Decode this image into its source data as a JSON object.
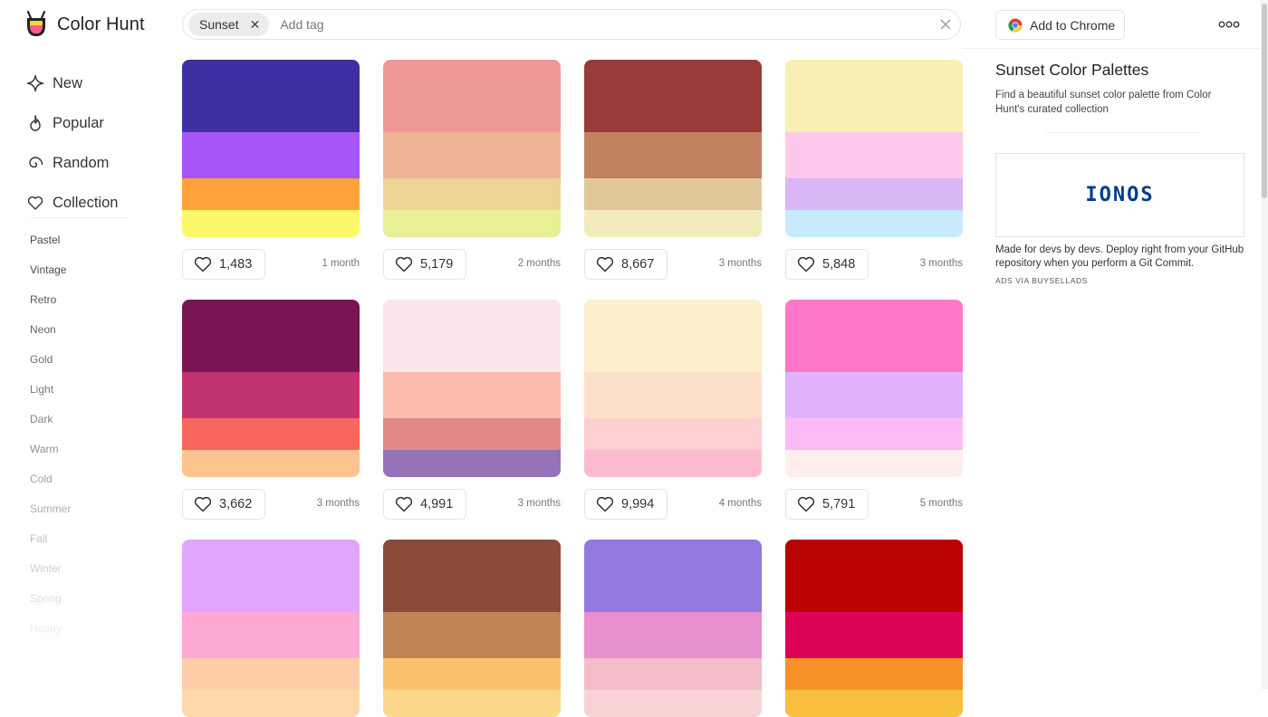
{
  "app": {
    "name": "Color Hunt"
  },
  "search": {
    "tag": "Sunset",
    "placeholder": "Add tag"
  },
  "header": {
    "chrome_label": "Add to Chrome"
  },
  "nav": [
    {
      "label": "New",
      "icon": "sparkle-icon"
    },
    {
      "label": "Popular",
      "icon": "flame-icon"
    },
    {
      "label": "Random",
      "icon": "spiral-icon"
    },
    {
      "label": "Collection",
      "icon": "heart-icon"
    }
  ],
  "tags": [
    {
      "label": "Pastel",
      "color": "#4a4a4a"
    },
    {
      "label": "Vintage",
      "color": "#505050"
    },
    {
      "label": "Retro",
      "color": "#5a5a5a"
    },
    {
      "label": "Neon",
      "color": "#646464"
    },
    {
      "label": "Gold",
      "color": "#6e6e6e"
    },
    {
      "label": "Light",
      "color": "#7a7a7a"
    },
    {
      "label": "Dark",
      "color": "#858585"
    },
    {
      "label": "Warm",
      "color": "#929292"
    },
    {
      "label": "Cold",
      "color": "#a0a0a0"
    },
    {
      "label": "Summer",
      "color": "#b0b0b0"
    },
    {
      "label": "Fall",
      "color": "#c0c0c0"
    },
    {
      "label": "Winter",
      "color": "#cfcfcf"
    },
    {
      "label": "Spring",
      "color": "#dedede"
    },
    {
      "label": "Happy",
      "color": "#ececec"
    }
  ],
  "palettes": [
    {
      "colors": [
        "#3f2fa4",
        "#a855f7",
        "#ffa23c",
        "#fdf86a"
      ],
      "likes": "1,483",
      "date": "1 month"
    },
    {
      "colors": [
        "#ee9896",
        "#efb497",
        "#ecd594",
        "#e9ef94"
      ],
      "likes": "5,179",
      "date": "2 months"
    },
    {
      "colors": [
        "#9a3a3a",
        "#c18262",
        "#e1c89c",
        "#f2ebbd"
      ],
      "likes": "8,667",
      "date": "3 months"
    },
    {
      "colors": [
        "#f9efb2",
        "#fec8ea",
        "#dab7f5",
        "#c8eafd"
      ],
      "likes": "5,848",
      "date": "3 months"
    },
    {
      "colors": [
        "#7b1453",
        "#c2346f",
        "#f6665c",
        "#fec490"
      ],
      "likes": "3,662",
      "date": "3 months"
    },
    {
      "colors": [
        "#fce5eb",
        "#fbbaae",
        "#e38787",
        "#9673b8"
      ],
      "likes": "4,991",
      "date": "3 months"
    },
    {
      "colors": [
        "#fdefcc",
        "#fde0cc",
        "#fdcfd0",
        "#fdbbcf"
      ],
      "likes": "9,994",
      "date": "4 months"
    },
    {
      "colors": [
        "#ff78c8",
        "#e1b2fd",
        "#fdbbf5",
        "#fdeeeb"
      ],
      "likes": "5,791",
      "date": "5 months"
    },
    {
      "colors": [
        "#e2a5fd",
        "#fda9d3",
        "#fdcea9",
        "#fdd9aa"
      ],
      "likes": "",
      "date": ""
    },
    {
      "colors": [
        "#8a4b39",
        "#c08556",
        "#fcc16e",
        "#fcd88c"
      ],
      "likes": "",
      "date": ""
    },
    {
      "colors": [
        "#9378df",
        "#e88fce",
        "#f2bdc8",
        "#f7d3d3"
      ],
      "likes": "",
      "date": ""
    },
    {
      "colors": [
        "#b90303",
        "#dc0457",
        "#f7922a",
        "#fbbf3f"
      ],
      "likes": "",
      "date": ""
    }
  ],
  "side": {
    "title": "Sunset Color Palettes",
    "description": "Find a beautiful sunset color palette from Color Hunt's curated collection"
  },
  "ad": {
    "logo": "IONOS",
    "text": "Made for devs by devs. Deploy right from your GitHub repository when you perform a Git Commit.",
    "via": "ADS VIA BUYSELLADS"
  }
}
